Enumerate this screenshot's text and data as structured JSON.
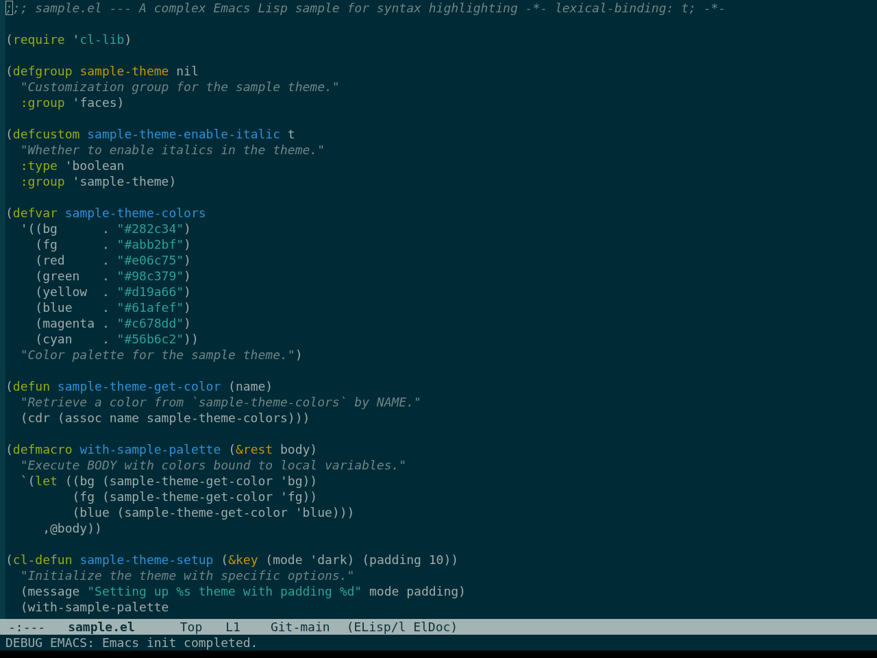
{
  "buffer": {
    "blocks": [
      [
        [
          {
            "kind": "cursor",
            "text": ";"
          },
          {
            "kind": "comment",
            "text": ";; sample.el --- A complex Emacs Lisp sample for syntax highlighting -*- lexical-binding: t; -*-"
          }
        ]
      ],
      [
        [
          {
            "kind": "plain",
            "text": "("
          },
          {
            "kind": "keyword",
            "text": "require"
          },
          {
            "kind": "plain",
            "text": " '"
          },
          {
            "kind": "constant",
            "text": "cl-lib"
          },
          {
            "kind": "plain",
            "text": ")"
          }
        ]
      ],
      [
        [
          {
            "kind": "plain",
            "text": "("
          },
          {
            "kind": "keyword",
            "text": "defgroup"
          },
          {
            "kind": "type",
            "text": " sample-theme"
          },
          {
            "kind": "plain",
            "text": " nil"
          }
        ],
        [
          {
            "kind": "doc",
            "text": "  \"Customization group for the sample theme.\""
          }
        ],
        [
          {
            "kind": "keyword",
            "text": "  :group"
          },
          {
            "kind": "plain",
            "text": " 'faces)"
          }
        ]
      ],
      [
        [
          {
            "kind": "plain",
            "text": "("
          },
          {
            "kind": "keyword",
            "text": "defcustom"
          },
          {
            "kind": "function",
            "text": " sample-theme-enable-italic"
          },
          {
            "kind": "plain",
            "text": " t"
          }
        ],
        [
          {
            "kind": "doc",
            "text": "  \"Whether to enable italics in the theme.\""
          }
        ],
        [
          {
            "kind": "keyword",
            "text": "  :type"
          },
          {
            "kind": "plain",
            "text": " 'boolean"
          }
        ],
        [
          {
            "kind": "keyword",
            "text": "  :group"
          },
          {
            "kind": "plain",
            "text": " 'sample-theme)"
          }
        ]
      ],
      [
        [
          {
            "kind": "plain",
            "text": "("
          },
          {
            "kind": "keyword",
            "text": "defvar"
          },
          {
            "kind": "function",
            "text": " sample-theme-colors"
          }
        ],
        [
          {
            "kind": "plain",
            "text": "  '((bg      . "
          },
          {
            "kind": "string",
            "text": "\"#282c34\""
          },
          {
            "kind": "plain",
            "text": ")"
          }
        ],
        [
          {
            "kind": "plain",
            "text": "    (fg      . "
          },
          {
            "kind": "string",
            "text": "\"#abb2bf\""
          },
          {
            "kind": "plain",
            "text": ")"
          }
        ],
        [
          {
            "kind": "plain",
            "text": "    (red     . "
          },
          {
            "kind": "string",
            "text": "\"#e06c75\""
          },
          {
            "kind": "plain",
            "text": ")"
          }
        ],
        [
          {
            "kind": "plain",
            "text": "    (green   . "
          },
          {
            "kind": "string",
            "text": "\"#98c379\""
          },
          {
            "kind": "plain",
            "text": ")"
          }
        ],
        [
          {
            "kind": "plain",
            "text": "    (yellow  . "
          },
          {
            "kind": "string",
            "text": "\"#d19a66\""
          },
          {
            "kind": "plain",
            "text": ")"
          }
        ],
        [
          {
            "kind": "plain",
            "text": "    (blue    . "
          },
          {
            "kind": "string",
            "text": "\"#61afef\""
          },
          {
            "kind": "plain",
            "text": ")"
          }
        ],
        [
          {
            "kind": "plain",
            "text": "    (magenta . "
          },
          {
            "kind": "string",
            "text": "\"#c678dd\""
          },
          {
            "kind": "plain",
            "text": ")"
          }
        ],
        [
          {
            "kind": "plain",
            "text": "    (cyan    . "
          },
          {
            "kind": "string",
            "text": "\"#56b6c2\""
          },
          {
            "kind": "plain",
            "text": "))"
          }
        ],
        [
          {
            "kind": "doc",
            "text": "  \"Color palette for the sample theme.\""
          },
          {
            "kind": "plain",
            "text": ")"
          }
        ]
      ],
      [
        [
          {
            "kind": "plain",
            "text": "("
          },
          {
            "kind": "keyword",
            "text": "defun"
          },
          {
            "kind": "function",
            "text": " sample-theme-get-color"
          },
          {
            "kind": "plain",
            "text": " (name)"
          }
        ],
        [
          {
            "kind": "doc",
            "text": "  \"Retrieve a color from `sample-theme-colors` by NAME.\""
          }
        ],
        [
          {
            "kind": "plain",
            "text": "  (cdr (assoc name sample-theme-colors)))"
          }
        ]
      ],
      [
        [
          {
            "kind": "plain",
            "text": "("
          },
          {
            "kind": "keyword",
            "text": "defmacro"
          },
          {
            "kind": "function",
            "text": " with-sample-palette"
          },
          {
            "kind": "plain",
            "text": " ("
          },
          {
            "kind": "type",
            "text": "&rest"
          },
          {
            "kind": "plain",
            "text": " body)"
          }
        ],
        [
          {
            "kind": "doc",
            "text": "  \"Execute BODY with colors bound to local variables.\""
          }
        ],
        [
          {
            "kind": "plain",
            "text": "  `("
          },
          {
            "kind": "keyword",
            "text": "let"
          },
          {
            "kind": "plain",
            "text": " ((bg (sample-theme-get-color 'bg))"
          }
        ],
        [
          {
            "kind": "plain",
            "text": "         (fg (sample-theme-get-color 'fg))"
          }
        ],
        [
          {
            "kind": "plain",
            "text": "         (blue (sample-theme-get-color 'blue)))"
          }
        ],
        [
          {
            "kind": "plain",
            "text": "     ,@body))"
          }
        ]
      ],
      [
        [
          {
            "kind": "plain",
            "text": "("
          },
          {
            "kind": "keyword",
            "text": "cl-defun"
          },
          {
            "kind": "function",
            "text": " sample-theme-setup"
          },
          {
            "kind": "plain",
            "text": " ("
          },
          {
            "kind": "type",
            "text": "&key"
          },
          {
            "kind": "plain",
            "text": " (mode 'dark) (padding 10))"
          }
        ],
        [
          {
            "kind": "doc",
            "text": "  \"Initialize the theme with specific options.\""
          }
        ],
        [
          {
            "kind": "plain",
            "text": "  (message "
          },
          {
            "kind": "string",
            "text": "\"Setting up %s theme with padding %d\""
          },
          {
            "kind": "plain",
            "text": " mode padding)"
          }
        ],
        [
          {
            "kind": "plain",
            "text": "  (with-sample-palette"
          }
        ]
      ]
    ]
  },
  "mode_line": {
    "status": "-:---",
    "buffer_name": "sample.el",
    "position": "Top",
    "line": "L1",
    "vc": "Git-main",
    "modes": "(ELisp/l ElDoc)"
  },
  "echo_area": "DEBUG EMACS: Emacs init completed."
}
